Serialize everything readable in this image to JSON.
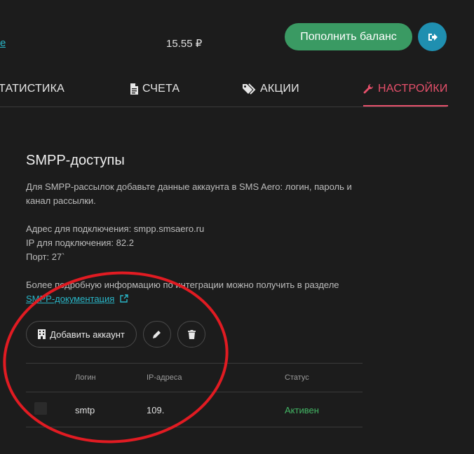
{
  "header": {
    "partial_link": "e",
    "balance": "15.55 ₽",
    "topup_label": "Пополнить баланс"
  },
  "tabs": [
    {
      "label": "ТАТИСТИКА",
      "icon": "chart-icon"
    },
    {
      "label": "СЧЕТА",
      "icon": "document-icon"
    },
    {
      "label": "АКЦИИ",
      "icon": "tags-icon"
    },
    {
      "label": "НАСТРОЙКИ",
      "icon": "wrench-icon",
      "active": true
    }
  ],
  "section": {
    "title": "SMPP-доступы",
    "intro_line1": "Для SMPP-рассылок добавьте данные аккаунта в SMS Aero: логин, пароль и",
    "intro_line2": "канал рассылки.",
    "address": "Адрес для подключения: smpp.smsaero.ru",
    "ip": "IP для подключения: 82.2",
    "port": "Порт: 27`",
    "more_info": "Более подробную информацию по интеграции можно получить в разделе",
    "doc_link": "SMPP-документация"
  },
  "actions": {
    "add_account": "Добавить аккаунт"
  },
  "table": {
    "columns": [
      "Логин",
      "IP-адреса",
      "Статус"
    ],
    "rows": [
      {
        "login": "smtp",
        "ip": "109.",
        "status": "Активен"
      }
    ]
  },
  "colors": {
    "accent_green": "#3a9a63",
    "accent_blue": "#1f8fb0",
    "active_tab": "#e6506b",
    "link": "#29b6c8",
    "status_active": "#43b665",
    "annotation_red": "#e11b22"
  }
}
